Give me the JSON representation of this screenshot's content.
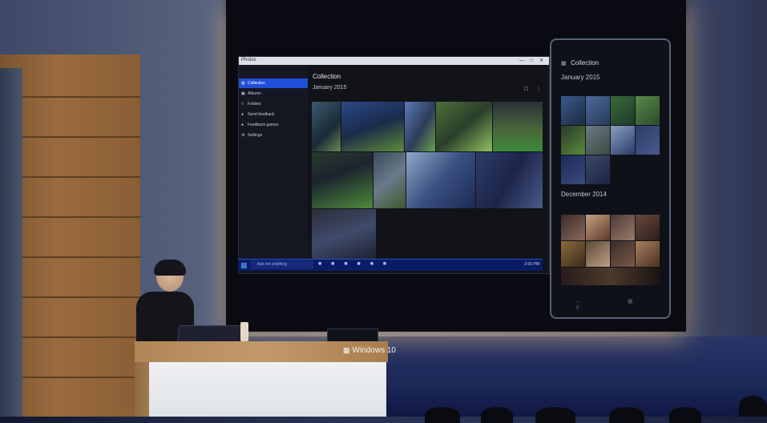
{
  "scene": "keynote-stage",
  "desktop_app": {
    "title_bar_label": "Photos",
    "window_controls": "— □ ✕",
    "sidebar": [
      {
        "label": "Collection",
        "icon": "collection-icon",
        "active": true
      },
      {
        "label": "Albums",
        "icon": "albums-icon",
        "active": false
      },
      {
        "label": "Folders",
        "icon": "folders-icon",
        "active": false
      },
      {
        "label": "Send feedback",
        "icon": "feedback-icon",
        "active": false
      },
      {
        "label": "Feedback games",
        "icon": "games-icon",
        "active": false
      },
      {
        "label": "Settings",
        "icon": "settings-icon",
        "active": false
      }
    ],
    "main_title": "Collection",
    "section_label": "January 2015",
    "accent_color": "#1f4fd8"
  },
  "taskbar": {
    "search_placeholder": "Ask me anything",
    "clock": "2:00 PM"
  },
  "phone_app": {
    "title": "Collection",
    "section_1": "January 2015",
    "section_2": "December 2014"
  },
  "podium": {
    "logo_text": "Windows 10"
  }
}
